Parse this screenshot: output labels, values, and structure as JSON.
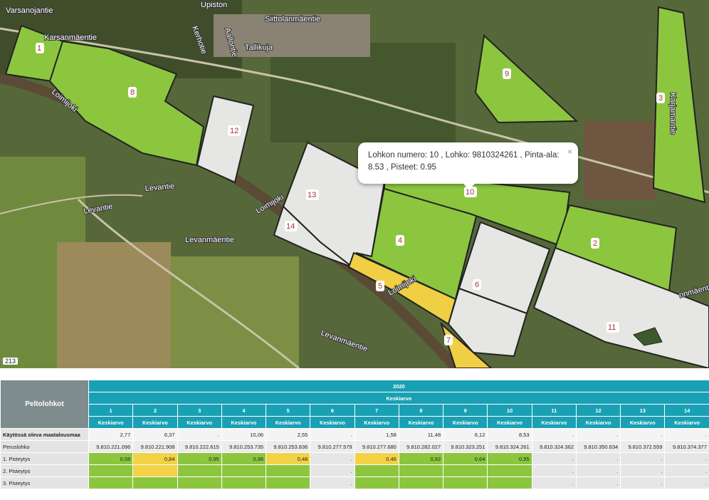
{
  "map": {
    "roads": [
      "Varsanojantie",
      "Karsanmäentie",
      "Siittolanmäentie",
      "Tallikuja",
      "Kerhotie",
      "Aallontie",
      "Upiston",
      "Levantie",
      "Levanmäentie",
      "Levanmäentie",
      "Loimijoki",
      "Loimijoki",
      "Loimijoki",
      "rinmäentie",
      "Levantie",
      "Karjamantie"
    ],
    "field_labels": [
      "1",
      "8",
      "12",
      "9",
      "3",
      "13",
      "14",
      "4",
      "10",
      "2",
      "5",
      "6",
      "7",
      "11"
    ],
    "scale_badge": "213",
    "popup": {
      "line1": "Lohkon numero: 10 , Lohko: 9810324261 , Pinta-ala:",
      "line2": "8.53 , Pisteet: 0.95",
      "close": "×"
    }
  },
  "table": {
    "corner": "Peltolohkot",
    "year": "2020",
    "metric": "Keskiarvo",
    "columns": [
      "1",
      "2",
      "3",
      "4",
      "5",
      "6",
      "7",
      "8",
      "9",
      "10",
      "11",
      "12",
      "13",
      "14"
    ],
    "sub": "Keskiarvo",
    "rows": [
      {
        "label": "Käytössä oleva maatalousmaa",
        "values": [
          "2,77",
          "6,37",
          ".",
          "10,06",
          "2,55",
          ".",
          "1,58",
          "11,48",
          "6,12",
          "8,53",
          ".",
          ".",
          ".",
          "."
        ]
      },
      {
        "label": "Peruslohko",
        "values": [
          "9.810.221.096",
          "9.810.221.908",
          "9.810.222.615",
          "9.810.253.735",
          "9.810.253.836",
          "9.810.277.579",
          "9.810.277.680",
          "9.810.282.027",
          "9.810.323.251",
          "9.810.324.261",
          "9.810.324.362",
          "9.810.350.634",
          "9.810.372.559",
          "9.810.374.377"
        ]
      },
      {
        "label": "1. Pisteytys",
        "values": [
          "0,58",
          "0,84",
          "0,95",
          "0,96",
          "0,48",
          ".",
          "0,46",
          "0,92",
          "0,64",
          "0,95",
          ".",
          ".",
          ".",
          "."
        ]
      },
      {
        "label": "2. Pisteytys",
        "values": [
          "",
          "",
          "",
          "",
          "",
          ".",
          "",
          "",
          "",
          "",
          ".",
          ".",
          ".",
          "."
        ]
      },
      {
        "label": "3. Pisteytys",
        "values": [
          "",
          "",
          "",
          "",
          "",
          ".",
          "",
          "",
          "",
          "",
          ".",
          ".",
          ".",
          "."
        ]
      }
    ],
    "colors": {
      "1": [
        "green",
        "yellow",
        "green",
        "green",
        "yellow",
        "empty",
        "yellow",
        "green",
        "green",
        "green",
        "empty",
        "empty",
        "empty",
        "empty"
      ],
      "2": [
        "green",
        "yellow",
        "green",
        "green",
        "green",
        "empty",
        "green",
        "green",
        "green",
        "green",
        "empty",
        "empty",
        "empty",
        "empty"
      ],
      "3": [
        "green",
        "green",
        "green",
        "green",
        "green",
        "empty",
        "green",
        "green",
        "green",
        "green",
        "empty",
        "empty",
        "empty",
        "empty"
      ],
      "0": [
        "green",
        "green",
        "green",
        "green",
        "yellow",
        "empty",
        "green",
        "green",
        "green",
        "green",
        "empty",
        "empty",
        "empty",
        "empty"
      ]
    }
  }
}
